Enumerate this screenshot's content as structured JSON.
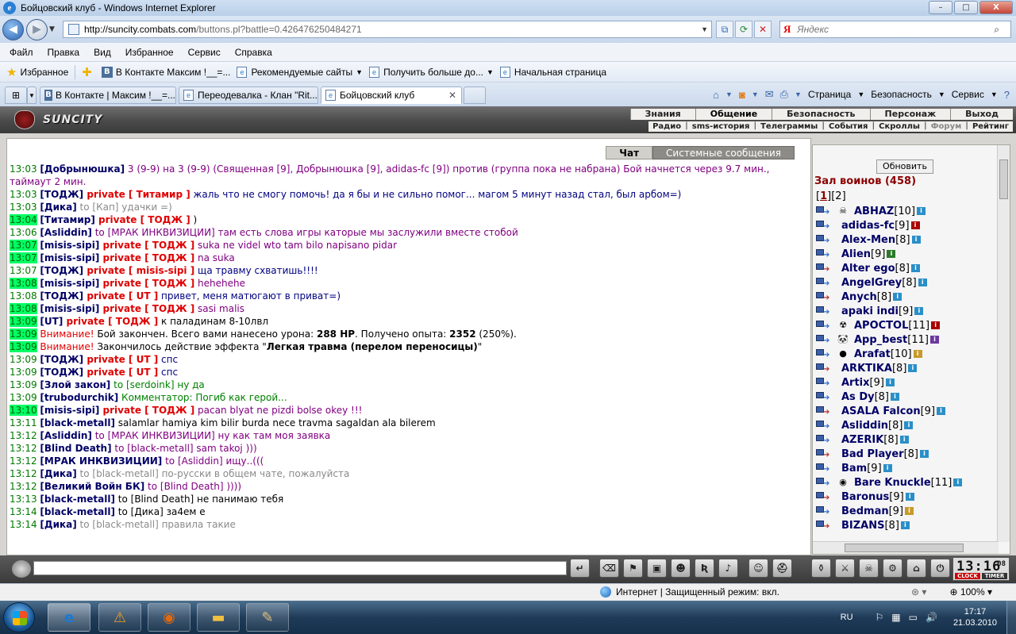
{
  "window": {
    "title": "Бойцовский клуб - Windows Internet Explorer",
    "controls": [
      "–",
      "□",
      "X"
    ]
  },
  "address": {
    "host": "http://suncity.combats.com",
    "rest": "/buttons.pl?battle=0.426476250484271"
  },
  "search": {
    "engine": "Я",
    "placeholder": "Яндекс"
  },
  "menu": [
    "Файл",
    "Правка",
    "Вид",
    "Избранное",
    "Сервис",
    "Справка"
  ],
  "favorites": {
    "label": "Избранное",
    "items": [
      "В Контакте  Максим !__=...",
      "Рекомендуемые сайты",
      "Получить больше до...",
      "Начальная страница"
    ]
  },
  "tabs": [
    "В Контакте | Максим !__=...",
    "Переодевалка - Клан \"Rit...",
    "Бойцовский клуб"
  ],
  "toolbar_right": [
    "Страница",
    "Безопасность",
    "Сервис"
  ],
  "game": {
    "logo": "SUNCITY",
    "nav_top": [
      "Знания",
      "Общение",
      "Безопасность",
      "Персонаж",
      "Выход"
    ],
    "nav_sub": [
      "Радио",
      "sms-история",
      "Телеграммы",
      "События",
      "Скроллы",
      "Форум",
      "Рейтинг"
    ],
    "chat_tabs": [
      "Чат",
      "Системные сообщения"
    ],
    "refresh": "Обновить",
    "room": "Зал воинов (458)",
    "pages": [
      "1",
      "2"
    ],
    "clock": {
      "time": "13:16",
      "sec": "08",
      "clock_label": "CLOCK",
      "timer_label": "TIMER"
    }
  },
  "chat": [
    {
      "t": "13:03",
      "hl": false,
      "wrap": true,
      "parts": [
        [
          "nm",
          "[Добрынюшка]"
        ],
        [
          "purple",
          " 3 (9-9) на 3 (9-9) (Священная [9], Добрынюшка [9], adidas-fc [9]) против (группа пока не набрана) Бой начнется через 9.7 мин., таймаут 2 мин."
        ]
      ]
    },
    {
      "t": "13:03",
      "hl": false,
      "parts": [
        [
          "nm",
          "[ТОДЖ]"
        ],
        [
          "pv",
          " private [ Титамир ]"
        ],
        [
          "navy",
          " жаль что не смогу помочь! да я бы и не сильно помог... магом 5 минут назад стал, был арбом=)"
        ]
      ]
    },
    {
      "t": "13:03",
      "hl": false,
      "parts": [
        [
          "nm",
          "[Дика]"
        ],
        [
          "grey",
          " to [Кап] удачки =)"
        ]
      ]
    },
    {
      "t": "13:04",
      "hl": true,
      "parts": [
        [
          "nm",
          "[Титамир]"
        ],
        [
          "pv",
          " private [ ТОДЖ ]"
        ],
        [
          "msg",
          " )"
        ]
      ]
    },
    {
      "t": "13:06",
      "hl": false,
      "parts": [
        [
          "nm",
          "[Asliddin]"
        ],
        [
          "purple",
          " to [МРАК ИНКВИЗИЦИИ] там есть слова игры каторые мы заслужили вместе стобой"
        ]
      ]
    },
    {
      "t": "13:07",
      "hl": true,
      "parts": [
        [
          "nm",
          "[misis-sipi]"
        ],
        [
          "pv",
          " private [ ТОДЖ ]"
        ],
        [
          "purple",
          " suka ne videl wto tam bilo napisano pidar"
        ]
      ]
    },
    {
      "t": "13:07",
      "hl": true,
      "parts": [
        [
          "nm",
          "[misis-sipi]"
        ],
        [
          "pv",
          " private [ ТОДЖ ]"
        ],
        [
          "purple",
          " na suka"
        ]
      ]
    },
    {
      "t": "13:07",
      "hl": false,
      "parts": [
        [
          "nm",
          "[ТОДЖ]"
        ],
        [
          "pv",
          " private [ misis-sipi ]"
        ],
        [
          "navy",
          " ща травму схватишь!!!!"
        ]
      ]
    },
    {
      "t": "13:08",
      "hl": true,
      "parts": [
        [
          "nm",
          "[misis-sipi]"
        ],
        [
          "pv",
          " private [ ТОДЖ ]"
        ],
        [
          "purple",
          " hehehehe"
        ]
      ]
    },
    {
      "t": "13:08",
      "hl": false,
      "parts": [
        [
          "nm",
          "[ТОДЖ]"
        ],
        [
          "pv",
          " private [ UT ]"
        ],
        [
          "navy",
          " привет, меня матюгают в приват=)"
        ]
      ]
    },
    {
      "t": "13:08",
      "hl": true,
      "parts": [
        [
          "nm",
          "[misis-sipi]"
        ],
        [
          "pv",
          " private [ ТОДЖ ]"
        ],
        [
          "purple",
          " sasi malis"
        ]
      ]
    },
    {
      "t": "13:09",
      "hl": true,
      "parts": [
        [
          "nm",
          "[UT]"
        ],
        [
          "pv",
          " private [ ТОДЖ ]"
        ],
        [
          "msg",
          " к паладинам 8-10лвл"
        ]
      ]
    },
    {
      "t": "13:09",
      "hl": true,
      "parts": [
        [
          "warn",
          " Внимание!"
        ],
        [
          "msg",
          " Бой закончен. Всего вами нанесено урона: "
        ],
        [
          "b",
          "288 HP"
        ],
        [
          "msg",
          ". Получено опыта: "
        ],
        [
          "b",
          "2352"
        ],
        [
          "msg",
          " (250%)."
        ]
      ]
    },
    {
      "t": "13:09",
      "hl": true,
      "parts": [
        [
          "warn",
          " Внимание!"
        ],
        [
          "msg",
          " Закончилось действие эффекта \""
        ],
        [
          "b",
          "Легкая травма (перелом переносицы)"
        ],
        [
          "msg",
          "\""
        ]
      ]
    },
    {
      "t": "13:09",
      "hl": false,
      "parts": [
        [
          "nm",
          "[ТОДЖ]"
        ],
        [
          "pv",
          " private [ UT ]"
        ],
        [
          "navy",
          " спс"
        ]
      ]
    },
    {
      "t": "13:09",
      "hl": false,
      "parts": [
        [
          "nm",
          "[ТОДЖ]"
        ],
        [
          "pv",
          " private [ UT ]"
        ],
        [
          "navy",
          " спс"
        ]
      ]
    },
    {
      "t": "13:09",
      "hl": false,
      "parts": [
        [
          "nm",
          "[Злой закон]"
        ],
        [
          "green",
          " to [serdoink] ну да"
        ]
      ]
    },
    {
      "t": "13:09",
      "hl": false,
      "parts": [
        [
          "nm",
          "[trubodurchik]"
        ],
        [
          "green",
          " Комментатор: Погиб как герой..."
        ]
      ]
    },
    {
      "t": "13:10",
      "hl": true,
      "parts": [
        [
          "nm",
          "[misis-sipi]"
        ],
        [
          "pv",
          " private [ ТОДЖ ]"
        ],
        [
          "purple",
          " pacan blyat ne pizdi bolse okey !!!"
        ]
      ]
    },
    {
      "t": "13:11",
      "hl": false,
      "parts": [
        [
          "nm",
          "[black-metall]"
        ],
        [
          "msg",
          " salamlar hamiya kim bilir burda nece travma sagaldan ala bilerem"
        ]
      ]
    },
    {
      "t": "13:12",
      "hl": false,
      "parts": [
        [
          "nm",
          "[Asliddin]"
        ],
        [
          "purple",
          " to [МРАК ИНКВИЗИЦИИ] ну как там моя заявка"
        ]
      ]
    },
    {
      "t": "13:12",
      "hl": false,
      "parts": [
        [
          "nm",
          "[Blind Death]"
        ],
        [
          "to",
          " to [black-metall] sam takoj )))"
        ]
      ]
    },
    {
      "t": "13:12",
      "hl": false,
      "parts": [
        [
          "nm",
          "[МРАК ИНКВИЗИЦИИ]"
        ],
        [
          "to",
          " to [Asliddin] ищу..((("
        ]
      ]
    },
    {
      "t": "13:12",
      "hl": false,
      "parts": [
        [
          "nm",
          "[Дика]"
        ],
        [
          "grey",
          " to [black-metall] по-русски в общем чате, пожалуйста"
        ]
      ]
    },
    {
      "t": "13:12",
      "hl": false,
      "parts": [
        [
          "nm",
          "[Великий Войн БК]"
        ],
        [
          "to",
          " to [Blind Death] ))))"
        ]
      ]
    },
    {
      "t": "13:13",
      "hl": false,
      "parts": [
        [
          "nm",
          "[black-metall]"
        ],
        [
          "msg",
          " to [Blind Death] не панимаю тебя"
        ]
      ]
    },
    {
      "t": "13:14",
      "hl": false,
      "parts": [
        [
          "nm",
          "[black-metall]"
        ],
        [
          "msg",
          " to [Дика] за4ем е"
        ]
      ]
    },
    {
      "t": "13:14",
      "hl": false,
      "parts": [
        [
          "nm",
          "[Дика]"
        ],
        [
          "grey",
          " to [black-metall] правила такие"
        ]
      ]
    }
  ],
  "players": [
    {
      "name": "ABHAZ",
      "lvl": "[10]",
      "clan": "☠",
      "alt": false,
      "inf": "c1"
    },
    {
      "name": "adidas-fc",
      "lvl": "[9]",
      "clan": "",
      "alt": false,
      "inf": "c2"
    },
    {
      "name": "Alex-Men",
      "lvl": "[8]",
      "clan": "",
      "alt": false,
      "inf": "c1"
    },
    {
      "name": "Alien",
      "lvl": "[9]",
      "clan": "",
      "alt": false,
      "inf": "c3"
    },
    {
      "name": "Alter ego",
      "lvl": "[8]",
      "clan": "",
      "alt": true,
      "inf": "c1"
    },
    {
      "name": "AngelGrey",
      "lvl": "[8]",
      "clan": "",
      "alt": false,
      "inf": "c1"
    },
    {
      "name": "Anych",
      "lvl": "[8]",
      "clan": "",
      "alt": true,
      "inf": "c1"
    },
    {
      "name": "apaki indi",
      "lvl": "[9]",
      "clan": "",
      "alt": false,
      "inf": "c1"
    },
    {
      "name": "APOCTOL",
      "lvl": "[11]",
      "clan": "☢",
      "alt": false,
      "inf": "c2"
    },
    {
      "name": "App_best",
      "lvl": "[11]",
      "clan": "🐼",
      "alt": false,
      "inf": "c4"
    },
    {
      "name": "Arafat",
      "lvl": "[10]",
      "clan": "●",
      "alt": false,
      "inf": "c5"
    },
    {
      "name": "ARKTIKA",
      "lvl": "[8]",
      "clan": "",
      "alt": true,
      "inf": "c1"
    },
    {
      "name": "Artix",
      "lvl": "[9]",
      "clan": "",
      "alt": false,
      "inf": "c1"
    },
    {
      "name": "As Dy",
      "lvl": "[8]",
      "clan": "",
      "alt": false,
      "inf": "c1"
    },
    {
      "name": "ASALA Falcon",
      "lvl": "[9]",
      "clan": "",
      "alt": true,
      "inf": "c1"
    },
    {
      "name": "Asliddin",
      "lvl": "[8]",
      "clan": "",
      "alt": false,
      "inf": "c1"
    },
    {
      "name": "AZERIK",
      "lvl": "[8]",
      "clan": "",
      "alt": false,
      "inf": "c1"
    },
    {
      "name": "Bad Player",
      "lvl": "[8]",
      "clan": "",
      "alt": true,
      "inf": "c1"
    },
    {
      "name": "Bam",
      "lvl": "[9]",
      "clan": "",
      "alt": false,
      "inf": "c1"
    },
    {
      "name": "Bare Knuckle",
      "lvl": "[11]",
      "clan": "◉",
      "alt": false,
      "inf": "c1"
    },
    {
      "name": "Baronus",
      "lvl": "[9]",
      "clan": "",
      "alt": true,
      "inf": "c1"
    },
    {
      "name": "Bedman",
      "lvl": "[9]",
      "clan": "",
      "alt": false,
      "inf": "c5"
    },
    {
      "name": "BIZANS",
      "lvl": "[8]",
      "clan": "",
      "alt": true,
      "inf": "c1"
    }
  ],
  "statusbar": {
    "zone": "Интернет | Защищенный режим: вкл.",
    "zoom": "100%"
  },
  "taskbar": {
    "lang": "RU",
    "time": "17:17",
    "date": "21.03.2010"
  }
}
